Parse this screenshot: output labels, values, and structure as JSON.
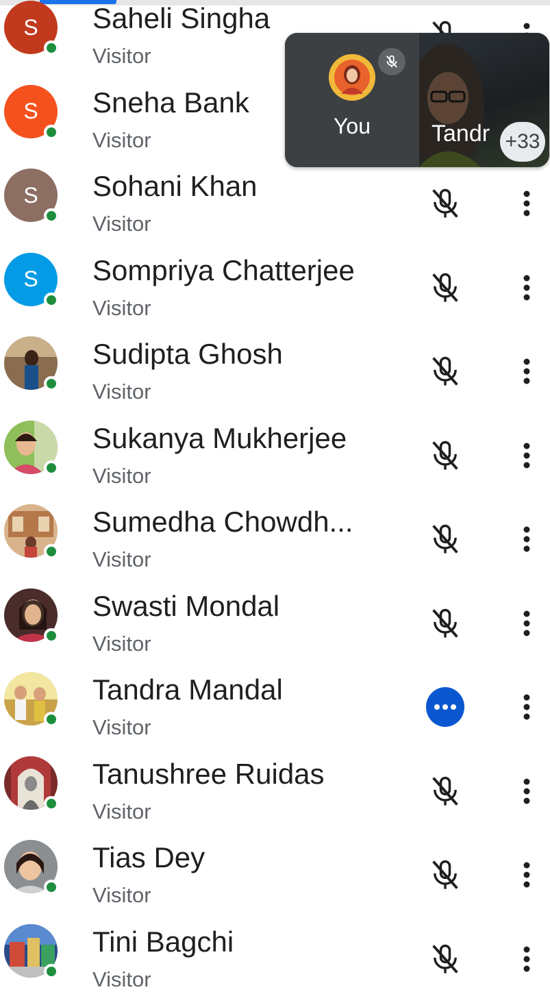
{
  "participants": [
    {
      "name": "Saheli Singha",
      "role": "Visitor",
      "avatar": {
        "type": "letter",
        "letter": "S",
        "color": "#c23a1e"
      },
      "mic": "muted"
    },
    {
      "name": "Sneha Bank",
      "role": "Visitor",
      "avatar": {
        "type": "letter",
        "letter": "S",
        "color": "#f4511e"
      },
      "mic": "muted"
    },
    {
      "name": "Sohani Khan",
      "role": "Visitor",
      "avatar": {
        "type": "letter",
        "letter": "S",
        "color": "#8d6e63"
      },
      "mic": "muted"
    },
    {
      "name": "Sompriya Chatterjee",
      "role": "Visitor",
      "avatar": {
        "type": "letter",
        "letter": "S",
        "color": "#039be5"
      },
      "mic": "muted"
    },
    {
      "name": "Sudipta Ghosh",
      "role": "Visitor",
      "avatar": {
        "type": "photo"
      },
      "mic": "muted"
    },
    {
      "name": "Sukanya Mukherjee",
      "role": "Visitor",
      "avatar": {
        "type": "photo"
      },
      "mic": "muted"
    },
    {
      "name": "Sumedha Chowdh...",
      "role": "Visitor",
      "avatar": {
        "type": "photo"
      },
      "mic": "muted"
    },
    {
      "name": "Swasti Mondal",
      "role": "Visitor",
      "avatar": {
        "type": "photo"
      },
      "mic": "muted"
    },
    {
      "name": "Tandra Mandal",
      "role": "Visitor",
      "avatar": {
        "type": "photo"
      },
      "mic": "speaking"
    },
    {
      "name": "Tanushree Ruidas",
      "role": "Visitor",
      "avatar": {
        "type": "photo"
      },
      "mic": "muted"
    },
    {
      "name": "Tias Dey",
      "role": "Visitor",
      "avatar": {
        "type": "photo"
      },
      "mic": "muted"
    },
    {
      "name": "Tini Bagchi",
      "role": "Visitor",
      "avatar": {
        "type": "photo"
      },
      "mic": "muted"
    }
  ],
  "pip": {
    "self_label": "You",
    "video_name": "Tandr",
    "more_count": "+33"
  },
  "icons": {
    "mic": "mic-off-icon",
    "menu": "more-vert-icon",
    "speaking": "speaking-dots-icon",
    "pip_mute": "mic-off-icon"
  },
  "colors": {
    "presence": "#1e8e3e",
    "accent": "#1a73e8",
    "speaking": "#0b57d0"
  }
}
